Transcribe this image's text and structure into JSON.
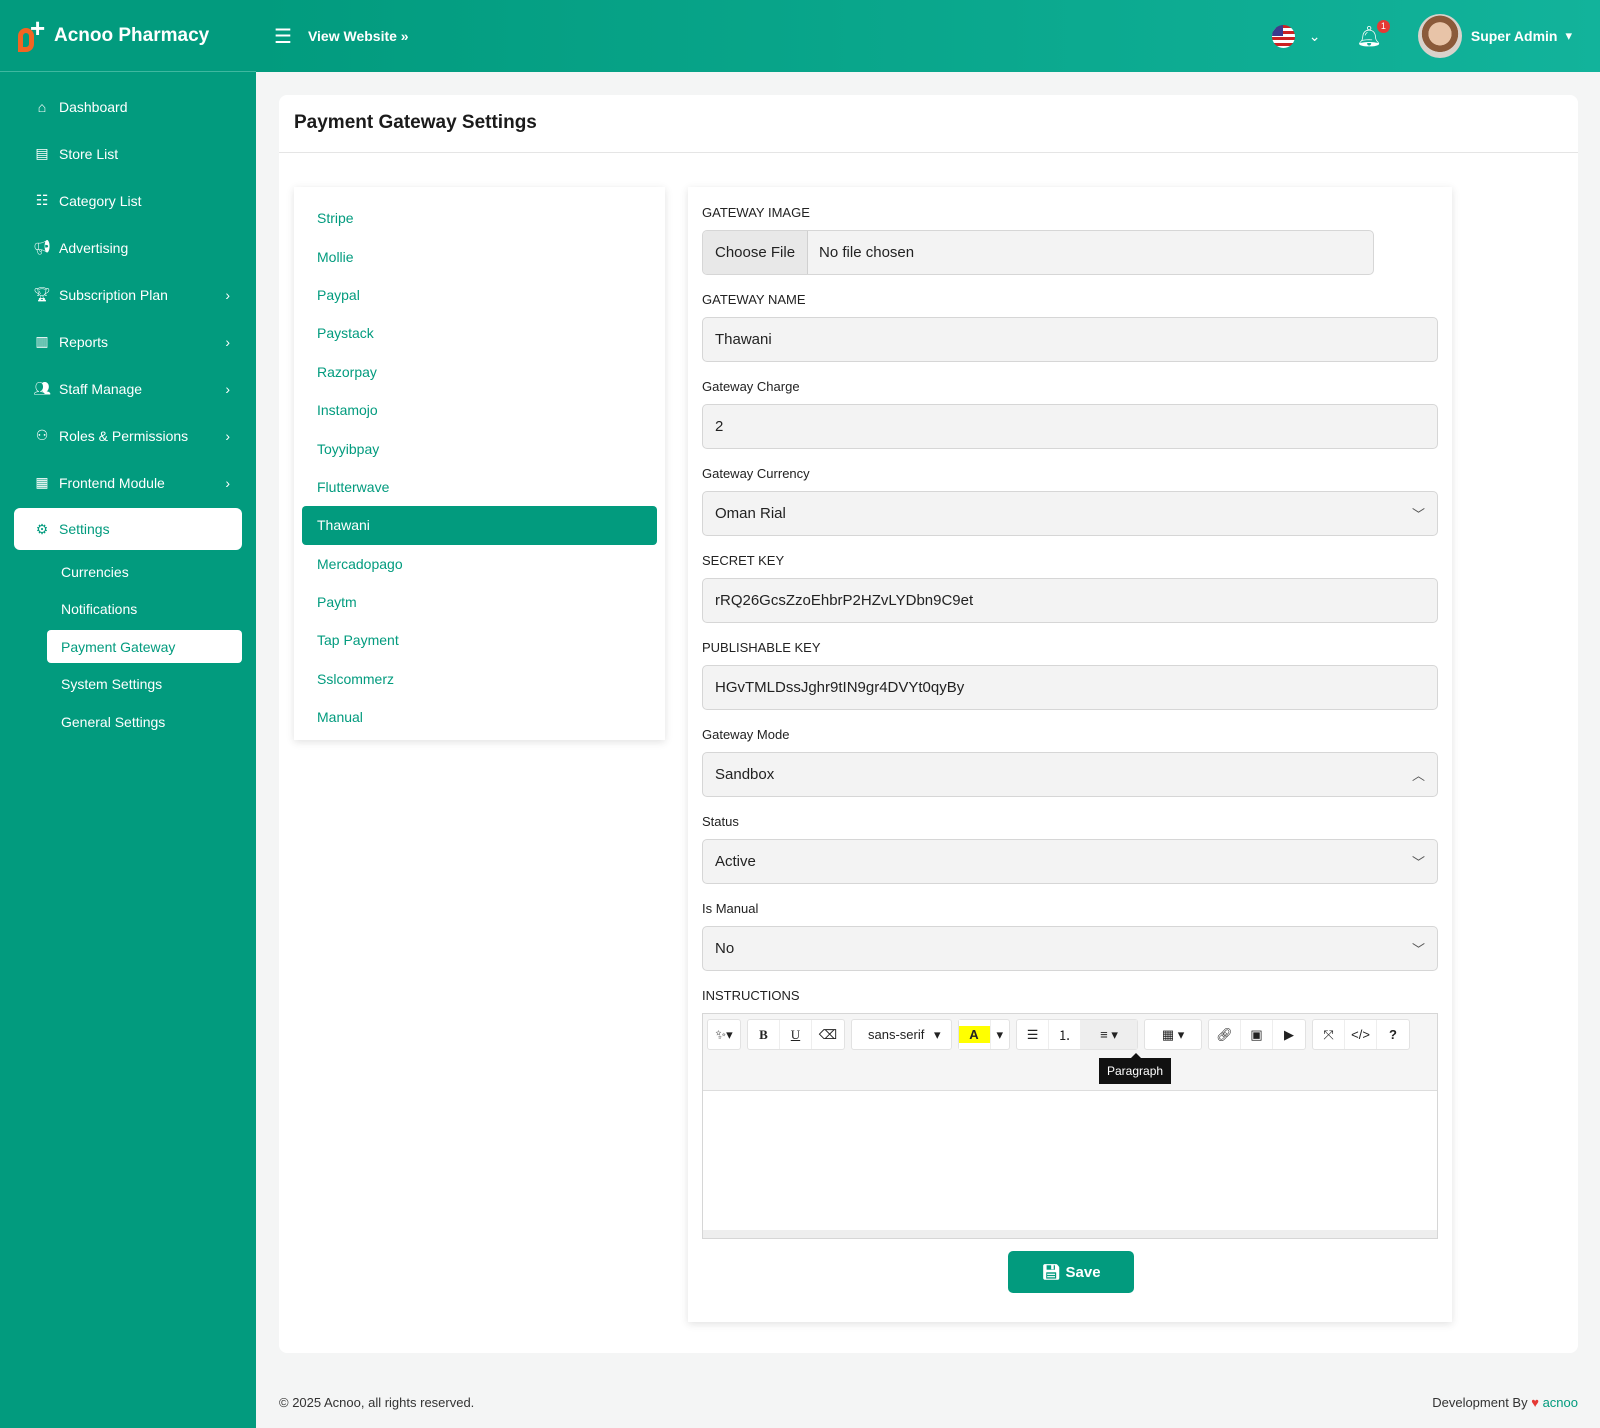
{
  "brand": {
    "name": "Acnoo Pharmacy"
  },
  "header": {
    "view_website": "View Website",
    "notification_count": "1",
    "user_name": "Super Admin"
  },
  "sidebar": {
    "items": [
      {
        "label": "Dashboard",
        "icon": "dashboard-icon",
        "chev": false
      },
      {
        "label": "Store List",
        "icon": "store-icon",
        "chev": false
      },
      {
        "label": "Category List",
        "icon": "list-icon",
        "chev": false
      },
      {
        "label": "Advertising",
        "icon": "megaphone-icon",
        "chev": false
      },
      {
        "label": "Subscription Plan",
        "icon": "trophy-icon",
        "chev": true
      },
      {
        "label": "Reports",
        "icon": "report-icon",
        "chev": true
      },
      {
        "label": "Staff Manage",
        "icon": "users-icon",
        "chev": true
      },
      {
        "label": "Roles & Permissions",
        "icon": "roles-icon",
        "chev": true
      },
      {
        "label": "Frontend Module",
        "icon": "frontend-icon",
        "chev": true
      }
    ],
    "settings_label": "Settings",
    "sub": [
      "Currencies",
      "Notifications",
      "Payment Gateway",
      "System Settings",
      "General Settings"
    ]
  },
  "page": {
    "title": "Payment Gateway Settings"
  },
  "gateways": [
    "Stripe",
    "Mollie",
    "Paypal",
    "Paystack",
    "Razorpay",
    "Instamojo",
    "Toyyibpay",
    "Flutterwave",
    "Thawani",
    "Mercadopago",
    "Paytm",
    "Tap Payment",
    "Sslcommerz",
    "Manual"
  ],
  "form": {
    "image_label": "GATEWAY IMAGE",
    "choose_file": "Choose File",
    "no_file": "No file chosen",
    "name_label": "GATEWAY NAME",
    "name": "Thawani",
    "charge_label": "Gateway Charge",
    "charge": "2",
    "currency_label": "Gateway Currency",
    "currency": "Oman Rial",
    "secret_label": "SECRET KEY",
    "secret": "rRQ26GcsZzoEhbrP2HZvLYDbn9C9et",
    "pub_label": "PUBLISHABLE KEY",
    "pub": "HGvTMLDssJghr9tIN9gr4DVYt0qyBy",
    "mode_label": "Gateway Mode",
    "mode": "Sandbox",
    "status_label": "Status",
    "status": "Active",
    "manual_label": "Is Manual",
    "manual": "No",
    "instr_label": "INSTRUCTIONS",
    "font": "sans-serif",
    "tooltip": "Paragraph",
    "save": "Save"
  },
  "footer": {
    "copy": "© 2025 Acnoo, all rights reserved.",
    "dev": "Development By",
    "dev_link": "acnoo"
  }
}
